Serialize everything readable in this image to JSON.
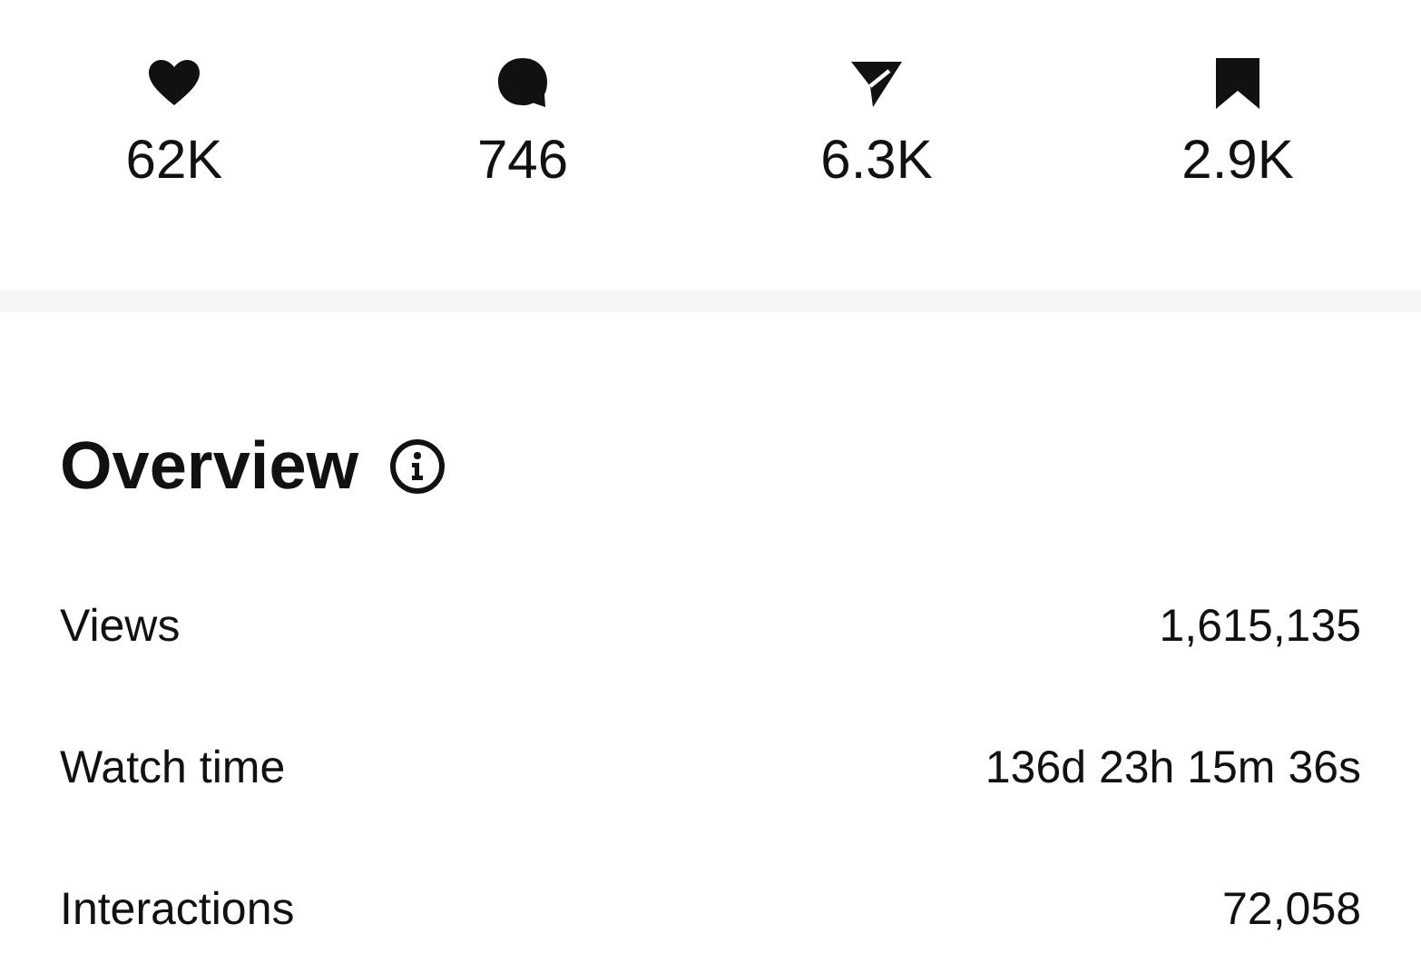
{
  "stats": [
    {
      "kind": "likes",
      "count": "62K"
    },
    {
      "kind": "comments",
      "count": "746"
    },
    {
      "kind": "shares",
      "count": "6.3K"
    },
    {
      "kind": "saves",
      "count": "2.9K"
    }
  ],
  "overview": {
    "title": "Overview",
    "rows": [
      {
        "label": "Views",
        "value": "1,615,135"
      },
      {
        "label": "Watch time",
        "value": "136d 23h 15m 36s"
      },
      {
        "label": "Interactions",
        "value": "72,058"
      }
    ]
  }
}
